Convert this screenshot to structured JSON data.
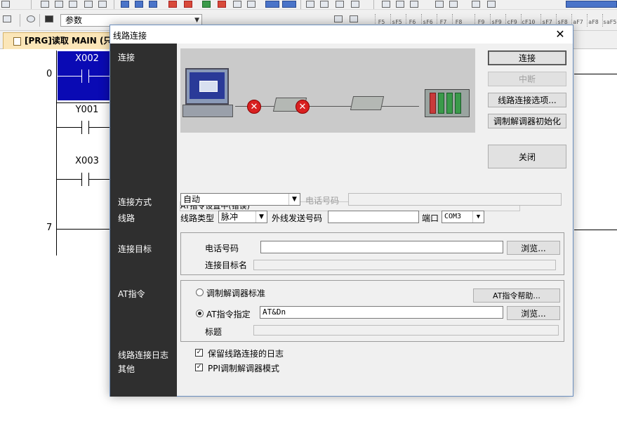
{
  "background": {
    "param_combo": "参数",
    "program_tab": "[PRG]读取 MAIN (只",
    "ladder": {
      "step0": "0",
      "step7": "7",
      "contacts": [
        "X002",
        "Y001",
        "X003"
      ]
    }
  },
  "dialog": {
    "title": "线路连接",
    "close_glyph": "✕",
    "sidebar": {
      "connect": "连接",
      "method": "连接方式",
      "line": "线路",
      "target": "连接目标",
      "at_command": "AT指令",
      "log": "线路连接日志",
      "other": "其他"
    },
    "buttons": {
      "connect": "连接",
      "disconnect": "中断",
      "line_options": "线路连接选项...",
      "modem_init": "调制解调器初始化",
      "close": "关闭"
    },
    "status_text": "AT指令设置中(错误)",
    "method": {
      "value": "自动",
      "phone_label": "电话号码",
      "phone_value": ""
    },
    "line": {
      "type_label": "线路类型",
      "type_value": "脉冲",
      "outside_label": "外线发送号码",
      "outside_value": "",
      "port_label": "端口",
      "port_value": "COM3"
    },
    "target": {
      "phone_label": "电话号码",
      "phone_value": "",
      "browse": "浏览...",
      "name_label": "连接目标名",
      "name_value": ""
    },
    "at": {
      "standard_label": "调制解调器标准",
      "help_button": "AT指令帮助...",
      "specify_label": "AT指令指定",
      "specify_value": "AT&Dn",
      "browse": "浏览...",
      "title_label": "标题",
      "title_value": "",
      "selected": "specify"
    },
    "options": {
      "keep_log_label": "保留线路连接的日志",
      "keep_log_checked": true,
      "ppi_label": "PPI调制解调器模式",
      "ppi_checked": true,
      "check_glyph": "✓"
    },
    "diagram": {
      "error_glyph": "✕"
    }
  }
}
